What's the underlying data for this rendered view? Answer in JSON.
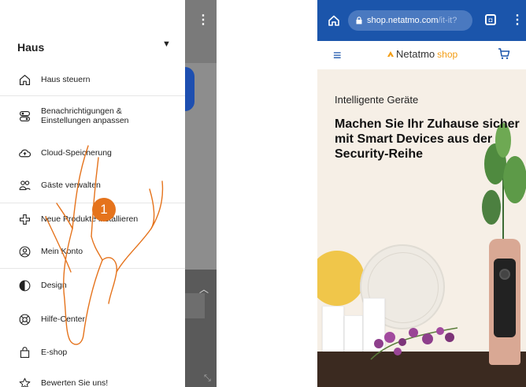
{
  "left_phone": {
    "drawer": {
      "home_selector": "Haus",
      "items": [
        {
          "label": "Haus steuern",
          "icon": "house-icon"
        },
        {
          "label": "Benachrichtigungen & Einstellungen anpassen",
          "label_line1": "Benachrichtigungen &",
          "label_line2": "Einstellungen anpassen",
          "icon": "settings-toggle-icon"
        },
        {
          "label": "Cloud-Speicherung",
          "icon": "cloud-upload-icon"
        },
        {
          "label": "Gäste verwalten",
          "icon": "guests-icon"
        },
        {
          "label": "Neue Produkte installieren",
          "icon": "add-product-icon"
        },
        {
          "label": "Mein Konto",
          "icon": "account-icon"
        },
        {
          "label": "Design",
          "icon": "contrast-icon"
        },
        {
          "label": "Hilfe-Center",
          "icon": "help-lifebuoy-icon"
        },
        {
          "label": "E-shop",
          "icon": "shopping-bag-icon"
        },
        {
          "label": "Bewerten Sie uns!",
          "icon": "star-icon"
        }
      ]
    },
    "step_badge": "1"
  },
  "right_phone": {
    "browser": {
      "url_host": "shop.netatmo.com",
      "url_path": "/it-it?"
    },
    "shop": {
      "brand": "Netatmo",
      "brand_suffix": "shop",
      "hero_subtitle": "Intelligente Geräte",
      "hero_title": "Machen Sie Ihr Zuhause sicher mit Smart Devices aus der Security-Reihe"
    }
  },
  "colors": {
    "accent_orange": "#e5731c",
    "browser_blue": "#1b55ab",
    "brand_orange": "#f39c12"
  }
}
